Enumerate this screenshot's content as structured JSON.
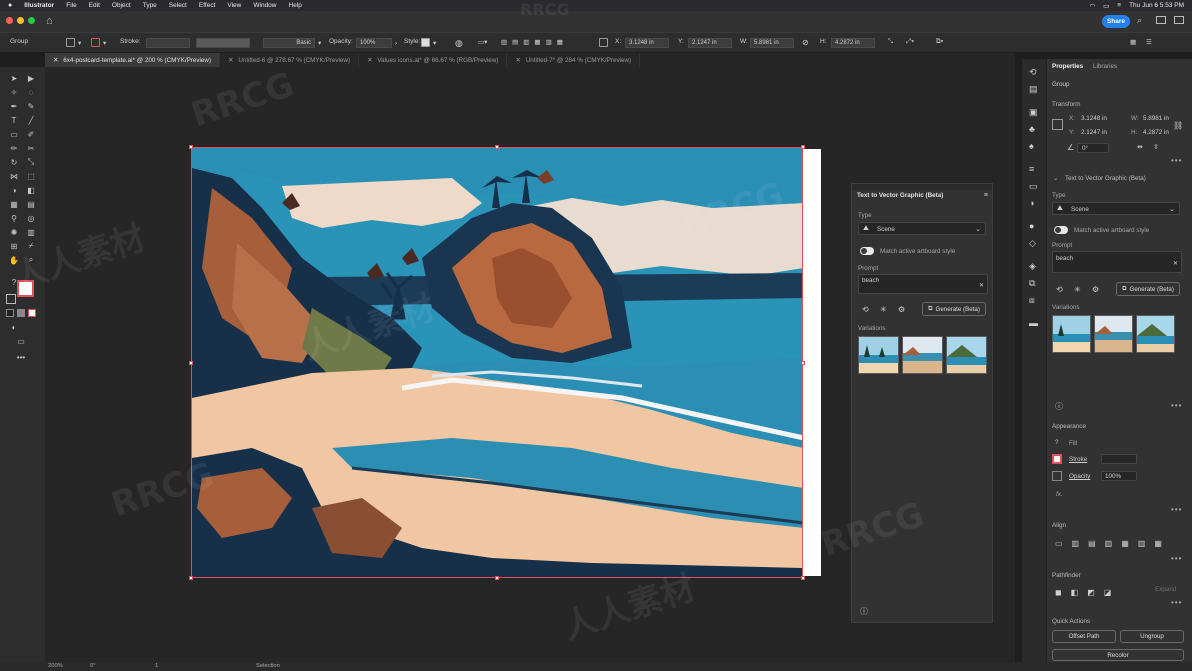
{
  "menubar": {
    "app_name": "Illustrator",
    "items": [
      "File",
      "Edit",
      "Object",
      "Type",
      "Select",
      "Effect",
      "View",
      "Window",
      "Help"
    ],
    "clock": "Thu Jun 6  5:53 PM"
  },
  "titlebar": {
    "share_label": "Share"
  },
  "controlbar": {
    "selection_label": "Group",
    "stroke_label": "Stroke:",
    "brush_value": "Basic",
    "opacity_label": "Opacity:",
    "opacity_value": "100%",
    "style_label": "Style:",
    "x_label": "X:",
    "x_value": "3.1248 in",
    "y_label": "Y:",
    "y_value": "2.1247 in",
    "w_label": "W:",
    "w_value": "5.8981 in",
    "h_label": "H:",
    "h_value": "4.2872 in"
  },
  "tabs": [
    {
      "label": "6x4-postcard-template.ai* @ 200 % (CMYK/Preview)",
      "active": true
    },
    {
      "label": "Untitled-6 @ 278.67 % (CMYK/Preview)",
      "active": false
    },
    {
      "label": "Values icons.ai* @ 66.67 % (RGB/Preview)",
      "active": false
    },
    {
      "label": "Untitled-7* @ 284 % (CMYK/Preview)",
      "active": false
    }
  ],
  "statusbar": {
    "zoom": "200%",
    "rotate": "0°",
    "artboard": "1",
    "mode": "Selection"
  },
  "t2v_panel": {
    "title": "Text to Vector Graphic (Beta)",
    "type_label": "Type",
    "type_value": "Scene",
    "match_label": "Match active artboard style",
    "prompt_label": "Prompt",
    "prompt_value": "beach",
    "generate_label": "Generate (Beta)",
    "variations_label": "Variations"
  },
  "properties": {
    "tab_properties": "Properties",
    "tab_libraries": "Libraries",
    "selection": "Group",
    "transform_title": "Transform",
    "x_label": "X:",
    "x_value": "3.1248 in",
    "y_label": "Y:",
    "y_value": "2.1247 in",
    "w_label": "W:",
    "w_value": "5.8981 in",
    "h_label": "H:",
    "h_value": "4.2872 in",
    "angle_value": "0°",
    "t2v_section": "Text to Vector Graphic (Beta)",
    "type_label": "Type",
    "type_value": "Scene",
    "match_label": "Match active artboard style",
    "prompt_label": "Prompt",
    "prompt_value": "beach",
    "generate_label": "Generate (Beta)",
    "variations_label": "Variations",
    "appearance_title": "Appearance",
    "fill_label": "Fill",
    "stroke_label": "Stroke",
    "opacity_label": "Opacity",
    "opacity_value": "100%",
    "fx_label": "fx.",
    "align_title": "Align",
    "pathfinder_title": "Pathfinder",
    "expand_label": "Expand",
    "quick_actions_title": "Quick Actions",
    "offset_path_label": "Offset Path",
    "ungroup_label": "Ungroup",
    "recolor_label": "Recolor"
  },
  "watermarks": [
    "RRCG",
    "人人素材"
  ],
  "colors": {
    "accent_blue": "#2680eb",
    "selection_red": "#e0505a",
    "panel_bg": "#323232",
    "canvas_bg": "#262626"
  }
}
